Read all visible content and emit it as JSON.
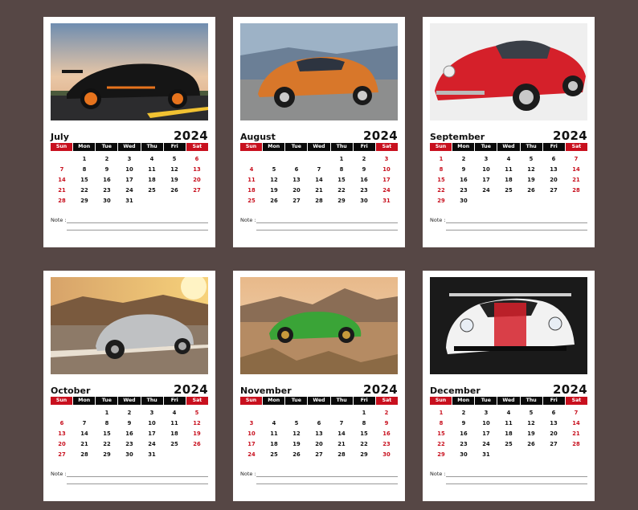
{
  "note_label": "Note :",
  "weekdays": [
    "Sun",
    "Mon",
    "Tue",
    "Wed",
    "Thu",
    "Fri",
    "Sat"
  ],
  "colors": {
    "background": "#564745",
    "accent_red": "#c8101e",
    "header_black": "#0a0a0a"
  },
  "months": [
    {
      "name": "July",
      "year": "2024",
      "start": 1,
      "days": 31,
      "photo": "black-porsche-gt3-orange-wheels"
    },
    {
      "name": "August",
      "year": "2024",
      "start": 4,
      "days": 31,
      "photo": "orange-classic-porsche-911"
    },
    {
      "name": "September",
      "year": "2024",
      "start": 0,
      "days": 30,
      "photo": "red-classic-porsche-911"
    },
    {
      "name": "October",
      "year": "2024",
      "start": 2,
      "days": 31,
      "photo": "silver-porsche-911-sunset"
    },
    {
      "name": "November",
      "year": "2024",
      "start": 5,
      "days": 30,
      "photo": "green-porsche-911-desert"
    },
    {
      "name": "December",
      "year": "2024",
      "start": 0,
      "days": 31,
      "photo": "white-porsche-rsr-race-car"
    }
  ]
}
